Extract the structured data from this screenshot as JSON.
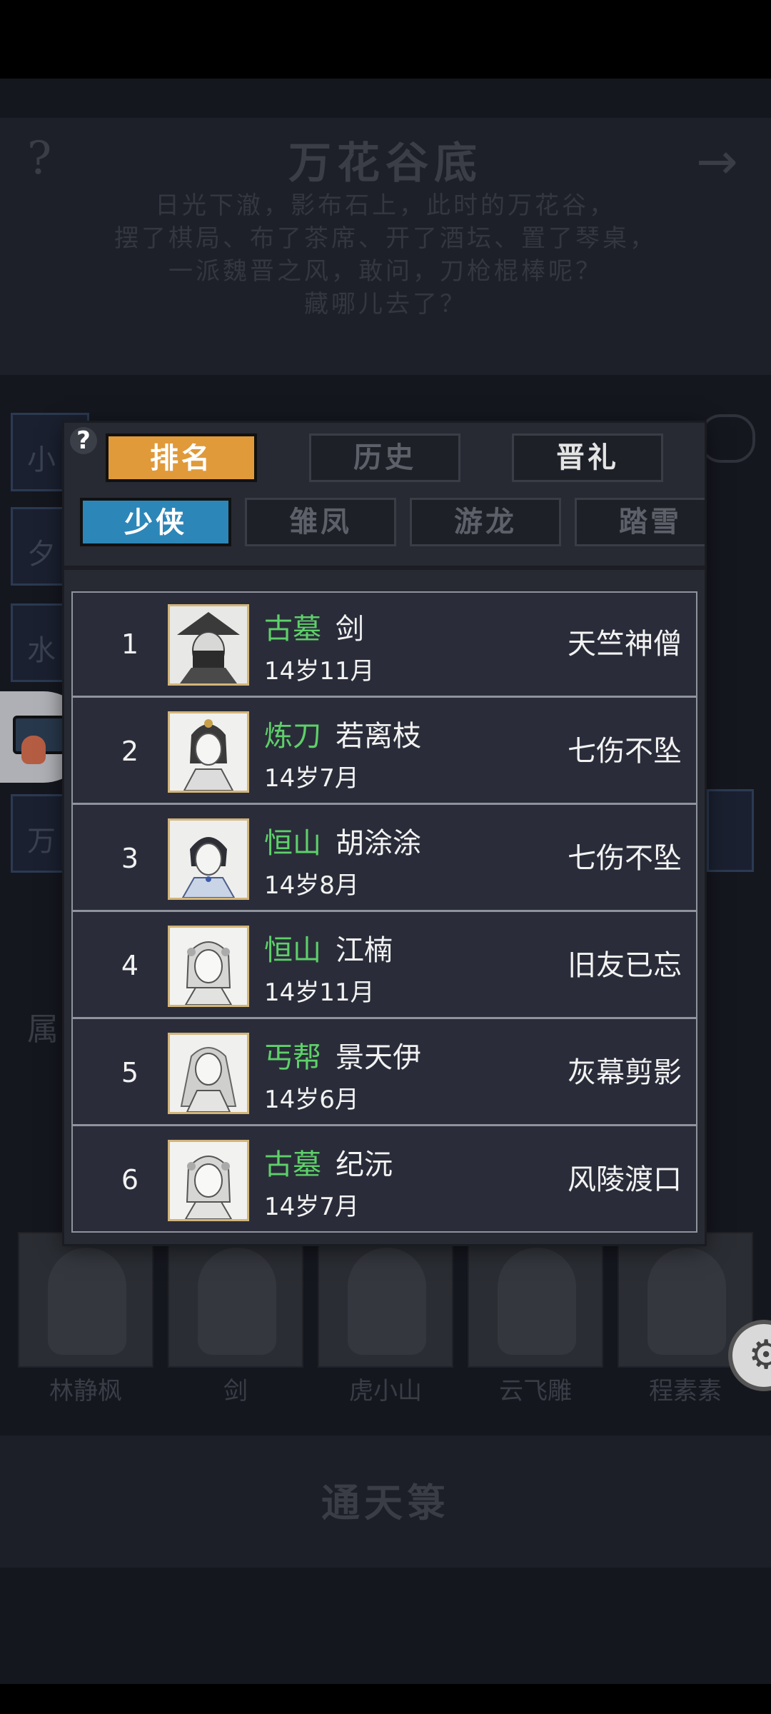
{
  "background": {
    "location_title": "万花谷底",
    "description_lines": [
      "日光下澈，影布石上，此时的万花谷，",
      "摆了棋局、布了茶席、开了酒坛、置了琴桌，",
      "一派魏晋之风，敢问，刀枪棍棒呢？",
      "藏哪儿去了？"
    ],
    "left_tabs": [
      "小",
      "夕",
      "水",
      "万"
    ],
    "side_label": "属",
    "portrait_names": [
      "林静枫",
      "剑",
      "虎小山",
      "云飞雕",
      "程素素"
    ],
    "bottom_button": "通天箓"
  },
  "dialog": {
    "help_glyph": "?",
    "top_tabs": [
      {
        "label": "排名",
        "active": true
      },
      {
        "label": "历史",
        "active": false
      },
      {
        "label": "晋礼",
        "active": false
      }
    ],
    "sub_tabs": [
      {
        "label": "少侠",
        "active": true
      },
      {
        "label": "雏凤",
        "active": false
      },
      {
        "label": "游龙",
        "active": false
      },
      {
        "label": "踏雪",
        "active": false
      }
    ],
    "ranking": [
      {
        "rank": "1",
        "sect": "古墓",
        "name": "剑",
        "age": "14岁11月",
        "title": "天竺神僧"
      },
      {
        "rank": "2",
        "sect": "炼刀",
        "name": "若离枝",
        "age": "14岁7月",
        "title": "七伤不坠"
      },
      {
        "rank": "3",
        "sect": "恒山",
        "name": "胡涂涂",
        "age": "14岁8月",
        "title": "七伤不坠"
      },
      {
        "rank": "4",
        "sect": "恒山",
        "name": "江楠",
        "age": "14岁11月",
        "title": "旧友已忘"
      },
      {
        "rank": "5",
        "sect": "丐帮",
        "name": "景天伊",
        "age": "14岁6月",
        "title": "灰幕剪影"
      },
      {
        "rank": "6",
        "sect": "古墓",
        "name": "纪沅",
        "age": "14岁7月",
        "title": "风陵渡口"
      }
    ]
  },
  "colors": {
    "sect_green": "#5ed06a",
    "active_top_tab": "#e09a3a",
    "active_sub_tab": "#2d86b8",
    "avatar_frame": "#d3b57a"
  }
}
